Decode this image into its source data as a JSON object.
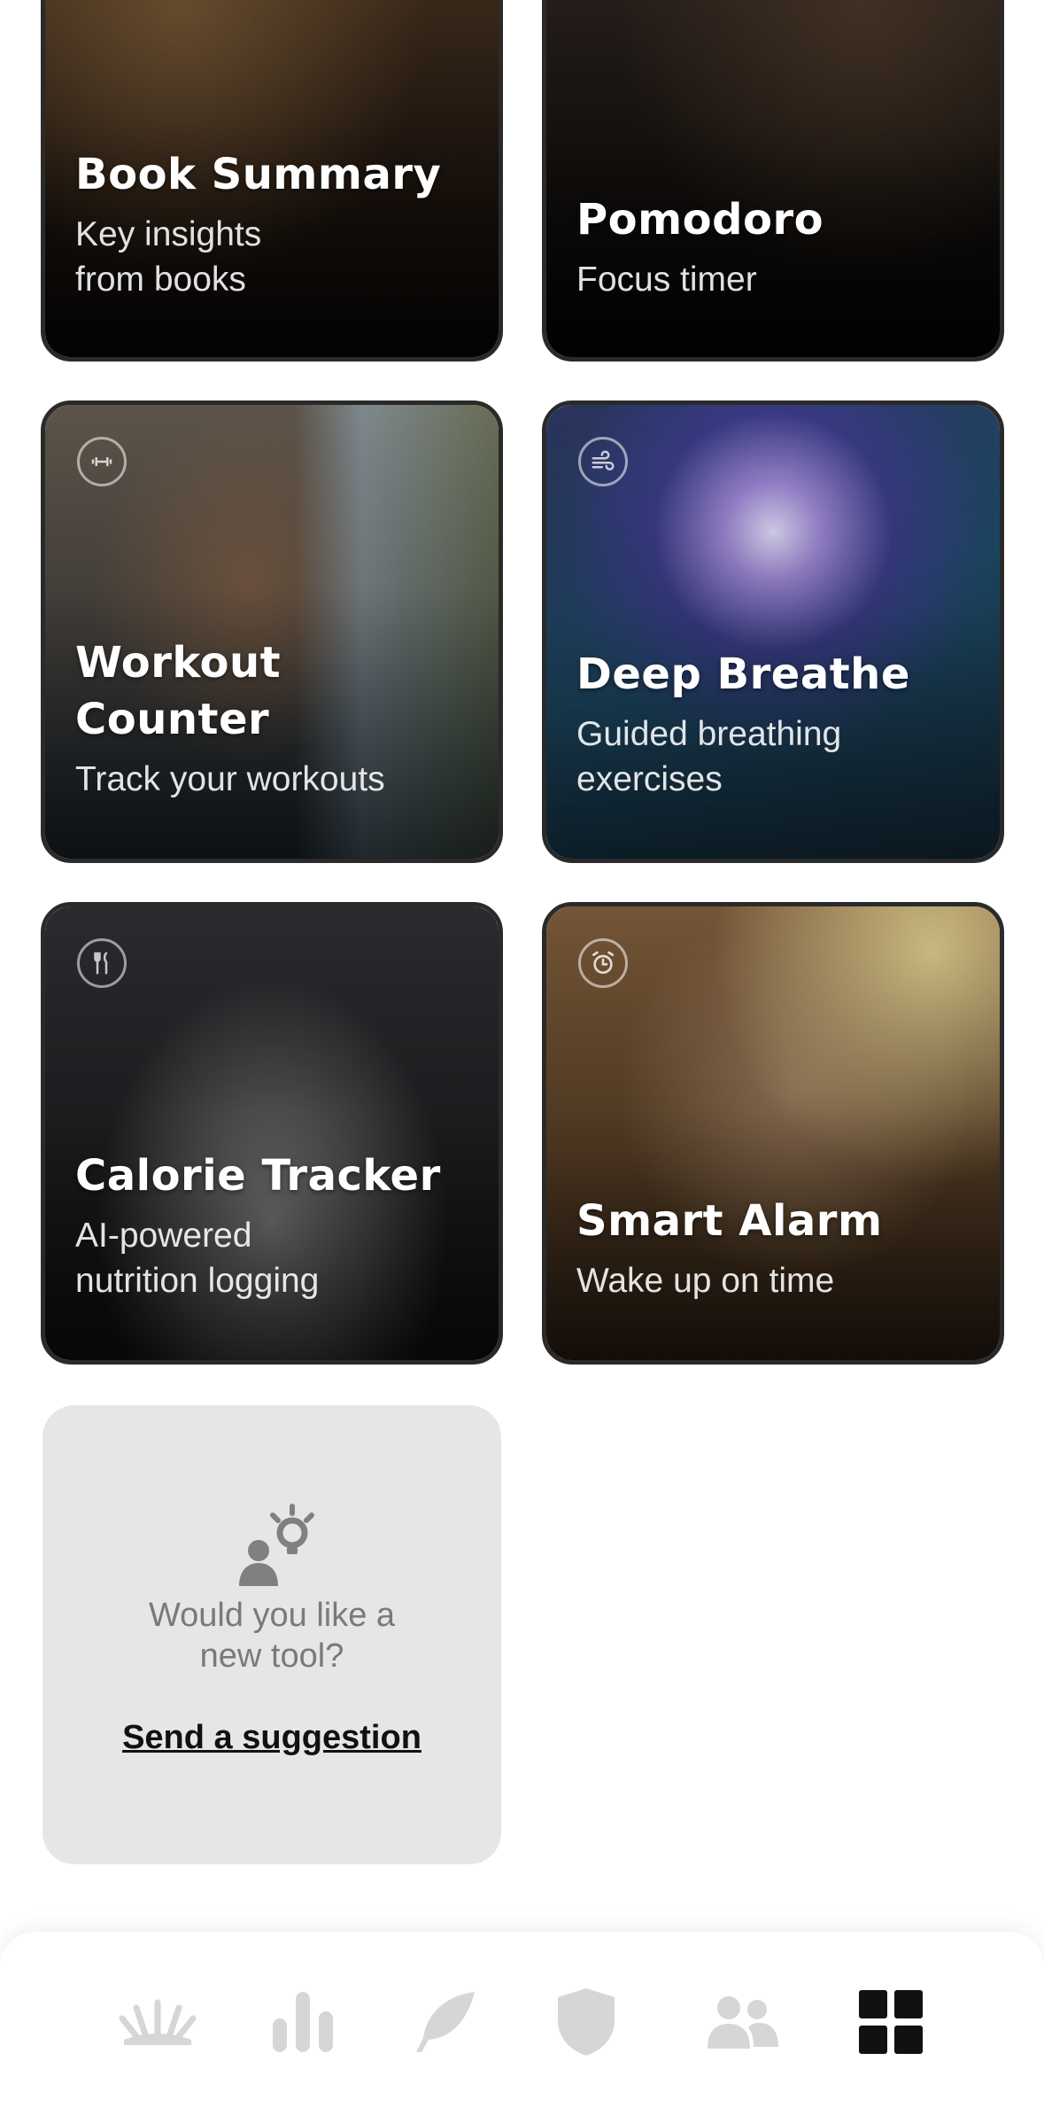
{
  "cards": [
    {
      "title_line1": "Book Summary",
      "title_line2": "",
      "subtitle_line1": "Key insights",
      "subtitle_line2": "from books",
      "icon": "book-icon"
    },
    {
      "title_line1": "Pomodoro",
      "title_line2": "",
      "subtitle_line1": "Focus timer",
      "subtitle_line2": "",
      "icon": "timer-icon"
    },
    {
      "title_line1": "Workout",
      "title_line2": "Counter",
      "subtitle_line1": "Track your workouts",
      "subtitle_line2": "",
      "icon": "dumbbell-icon"
    },
    {
      "title_line1": "Deep Breathe",
      "title_line2": "",
      "subtitle_line1": "Guided breathing",
      "subtitle_line2": "exercises",
      "icon": "wind-icon"
    },
    {
      "title_line1": "Calorie Tracker",
      "title_line2": "",
      "subtitle_line1": "AI-powered",
      "subtitle_line2": "nutrition logging",
      "icon": "utensils-icon"
    },
    {
      "title_line1": "Smart Alarm",
      "title_line2": "",
      "subtitle_line1": "Wake up on time",
      "subtitle_line2": "",
      "icon": "alarm-clock-icon"
    }
  ],
  "suggestion": {
    "question_line1": "Would you like a",
    "question_line2": "new tool?",
    "link_label": "Send a suggestion",
    "icon": "person-lightbulb-icon"
  },
  "tabbar": {
    "items": [
      {
        "icon": "sunrise-icon",
        "active": false
      },
      {
        "icon": "bar-chart-icon",
        "active": false
      },
      {
        "icon": "feather-icon",
        "active": false
      },
      {
        "icon": "shield-icon",
        "active": false
      },
      {
        "icon": "people-icon",
        "active": false
      },
      {
        "icon": "grid-icon",
        "active": true
      }
    ]
  },
  "colors": {
    "inactive_tab": "#d6d6d6",
    "active_tab": "#111111",
    "suggestion_bg": "#e6e6e6"
  }
}
